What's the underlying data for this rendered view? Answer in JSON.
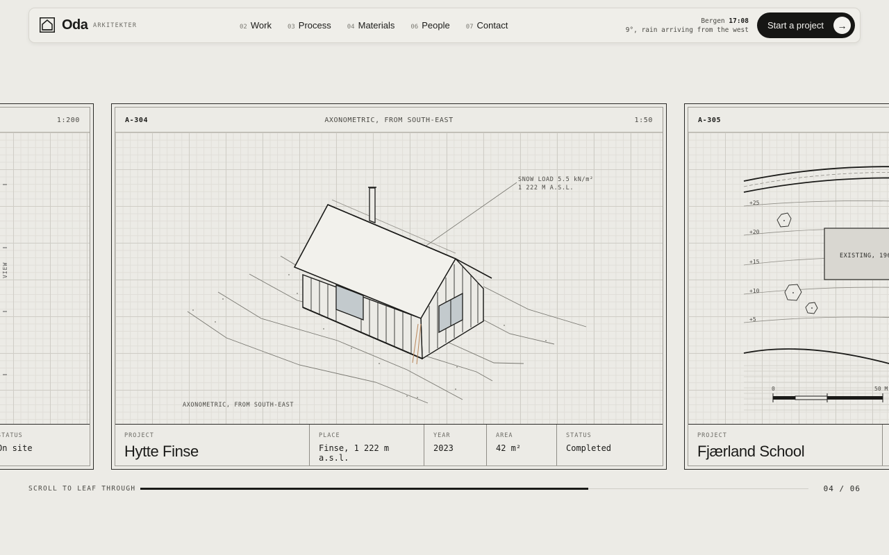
{
  "header": {
    "brand": "Oda",
    "brand_sub": "ARKITEKTER",
    "nav": [
      {
        "num": "02",
        "label": "Work"
      },
      {
        "num": "03",
        "label": "Process"
      },
      {
        "num": "04",
        "label": "Materials"
      },
      {
        "num": "06",
        "label": "People"
      },
      {
        "num": "07",
        "label": "Contact"
      }
    ],
    "weather": {
      "city": "Bergen",
      "time": "17:08",
      "conditions": "9°, rain arriving from the west"
    },
    "cta_label": "Start a project"
  },
  "cards": {
    "left": {
      "scale": "1:200",
      "side_label": "VIEW",
      "status_label": "STATUS",
      "status_value": "On site"
    },
    "center": {
      "sheet_id": "A-304",
      "sheet_title": "AXONOMETRIC, FROM SOUTH-EAST",
      "scale": "1:50",
      "annotation_line1": "SNOW LOAD 5.5 kN/m²",
      "annotation_line2": "1 222 M A.S.L.",
      "caption": "AXONOMETRIC, FROM SOUTH-EAST",
      "project_label": "PROJECT",
      "project": "Hytte Finse",
      "place_label": "PLACE",
      "place": "Finse, 1 222 m a.s.l.",
      "year_label": "YEAR",
      "year": "2023",
      "area_label": "AREA",
      "area": "42 m²",
      "status_label": "STATUS",
      "status": "Completed"
    },
    "right": {
      "sheet_id": "A-305",
      "contours": [
        "+25",
        "+20",
        "+15",
        "+10",
        "+5"
      ],
      "existing_label": "EXISTING, 196",
      "scale_start": "0",
      "scale_end": "50 M",
      "project_label": "PROJECT",
      "project": "Fjærland School"
    }
  },
  "footer": {
    "hint": "SCROLL TO LEAF THROUGH",
    "progress": 0.67,
    "pager": "04 / 06"
  }
}
